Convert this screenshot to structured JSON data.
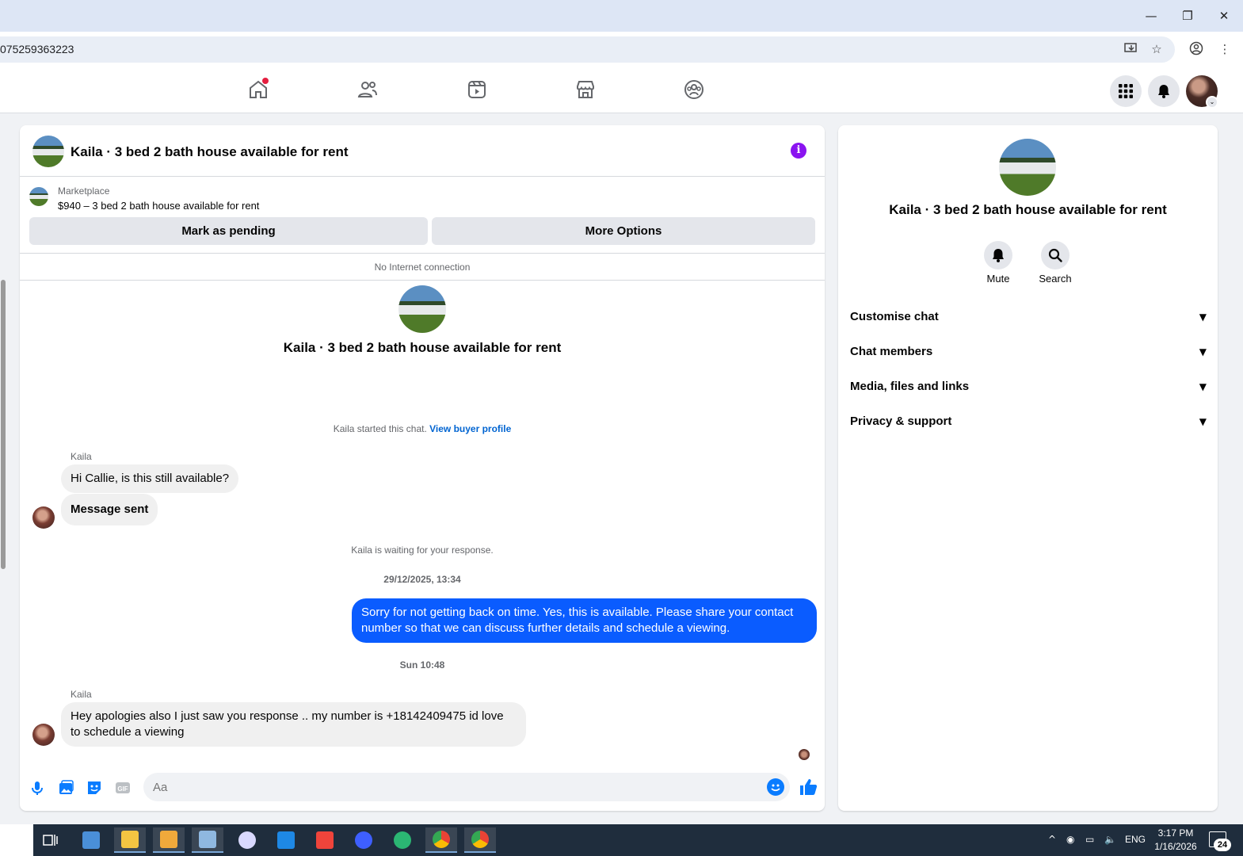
{
  "browser": {
    "url": "075259363223",
    "window_controls": {
      "minimize": "—",
      "restore": "❐",
      "close": "✕"
    }
  },
  "fb_nav": {
    "items": [
      "home-icon",
      "friends-icon",
      "video-icon",
      "marketplace-icon",
      "groups-icon"
    ],
    "right": [
      "menu-grid-icon",
      "notifications-bell-icon",
      "account-avatar"
    ]
  },
  "chat": {
    "header_title": "Kaila · 3 bed 2 bath house available for rent",
    "marketplace_label": "Marketplace",
    "listing": "$940 – 3 bed 2 bath house available for rent",
    "mark_pending": "Mark as pending",
    "more_options": "More Options",
    "connection_notice": "No Internet connection",
    "center_title": "Kaila · 3 bed 2 bath house available for rent",
    "started_text": "Kaila started this chat. ",
    "view_buyer_profile": "View buyer profile",
    "messages": [
      {
        "sender": "Kaila",
        "text": "Hi Callie, is this still available?"
      },
      {
        "text": "Message sent"
      }
    ],
    "waiting_text": "Kaila is waiting for your response.",
    "timestamp_1": "29/12/2025, 13:34",
    "outgoing": "Sorry for not getting back on time. Yes, this is available. Please share your contact number so that we can discuss further details and schedule a viewing.",
    "timestamp_2": "Sun 10:48",
    "reply_sender": "Kaila",
    "reply": "Hey apologies also I just saw you response .. my number is +18142409475 id love to schedule a viewing",
    "composer_placeholder": "Aa",
    "composer_icons": [
      "microphone-icon",
      "photo-icon",
      "sticker-icon",
      "gif-icon",
      "emoji-icon",
      "like-icon"
    ],
    "gif_label": "GIF"
  },
  "panel": {
    "title": "Kaila · 3 bed 2 bath house available for rent",
    "mute": "Mute",
    "search": "Search",
    "sections": [
      "Customise chat",
      "Chat members",
      "Media, files and links",
      "Privacy & support"
    ]
  },
  "taskbar": {
    "lang": "ENG",
    "time": "3:17 PM",
    "date": "1/16/2026",
    "notifications": "24"
  },
  "colors": {
    "messenger_blue": "#0a5cff",
    "link_blue": "#0064d1",
    "info_purple": "#8a13f0",
    "notification_red": "#e41e3f"
  }
}
